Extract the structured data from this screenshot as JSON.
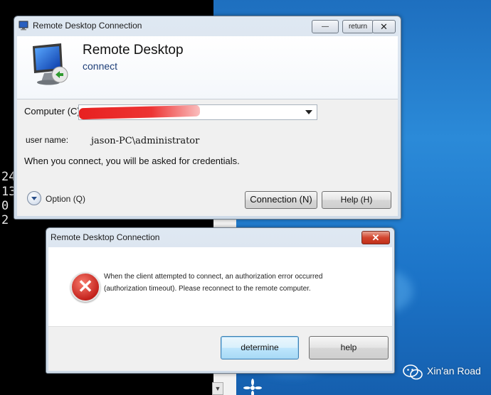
{
  "background": {
    "console_lines": [
      "24",
      "13",
      "0",
      "2"
    ]
  },
  "rdc_window": {
    "title": "Remote Desktop Connection",
    "minimize_symbol": "—",
    "restore_label": "return",
    "close_symbol": "✕",
    "header_title": "Remote Desktop",
    "header_subtitle": "connect",
    "computer_label": "Computer (C):",
    "user_label": "user name:",
    "user_value": "jason-PC\\administrator",
    "credentials_note": "When you connect, you will be asked for credentials.",
    "options_label": "Option (Q)",
    "connect_button": "Connection (N)",
    "help_button": "Help (H)"
  },
  "error_dialog": {
    "title": "Remote Desktop Connection",
    "close_symbol": "✕",
    "icon_symbol": "✕",
    "message_line1": "When the client attempted to connect, an authorization error occurred",
    "message_line2": "(authorization timeout). Please reconnect to the remote computer.",
    "determine_button": "determine",
    "help_button": "help"
  },
  "watermark": {
    "text": "Xin'an Road"
  },
  "colors": {
    "desktop_blue": "#1e6fbf",
    "error_red": "#c4221c",
    "redaction": "#e61414"
  }
}
